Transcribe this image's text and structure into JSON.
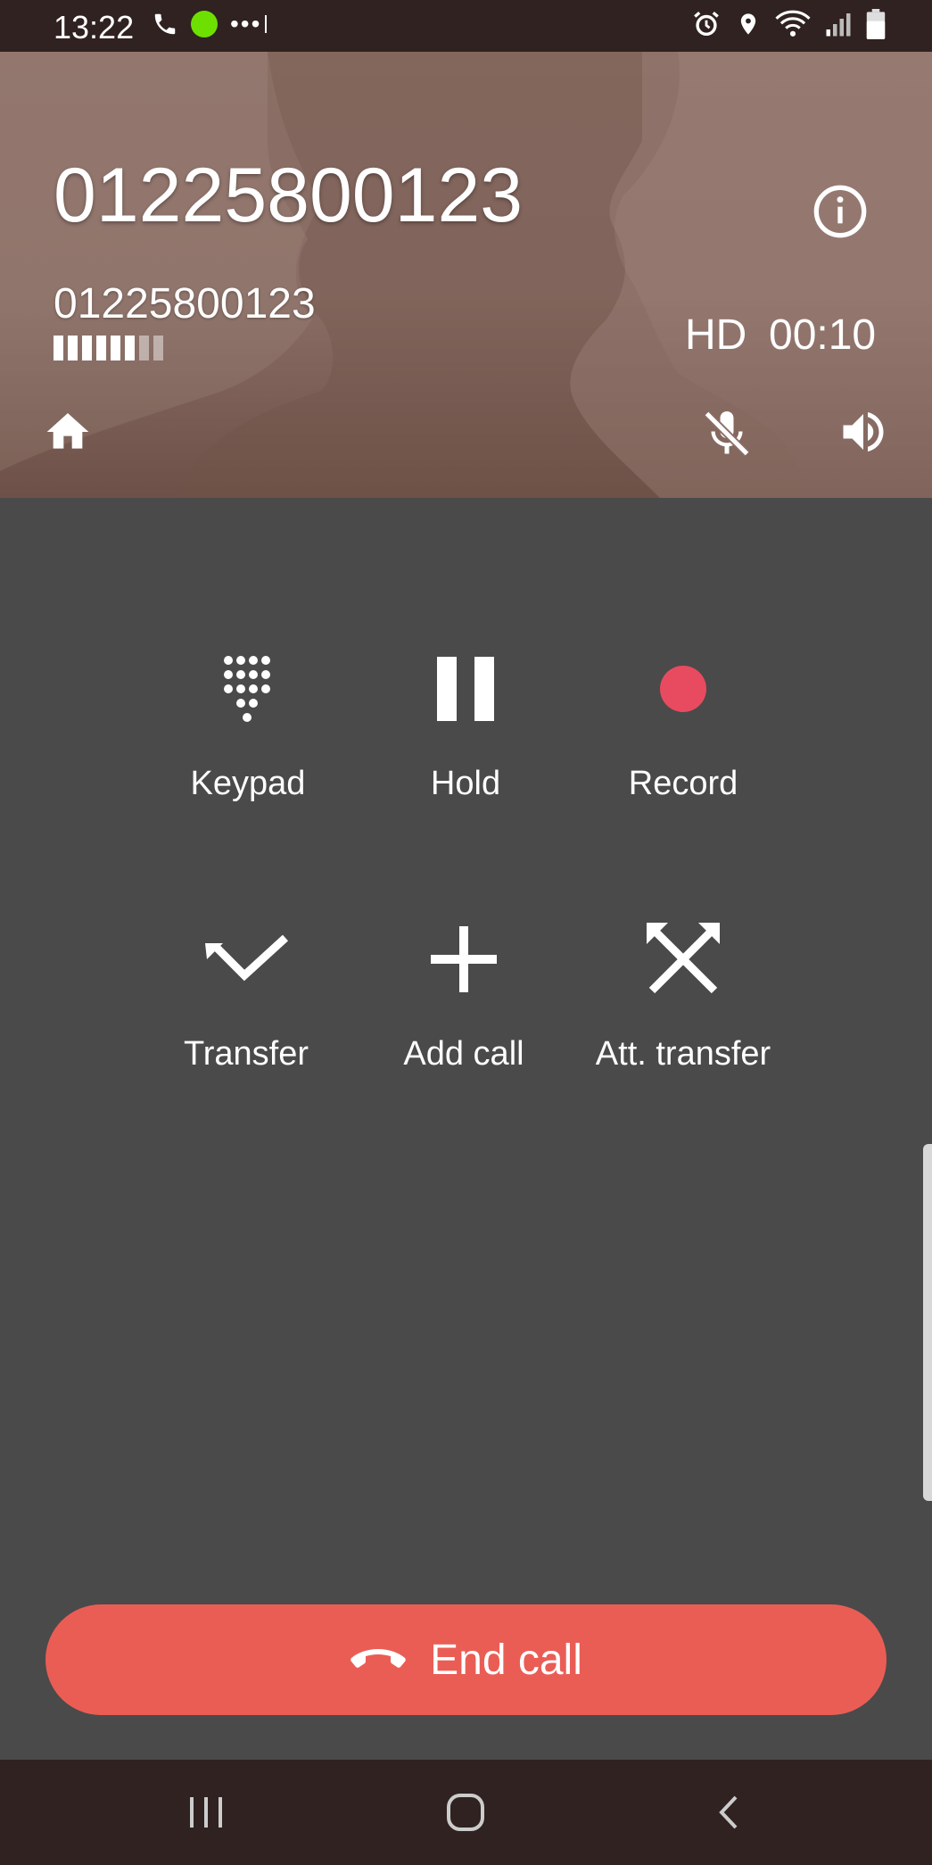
{
  "status_bar": {
    "time": "13:22",
    "more": "•••"
  },
  "call": {
    "name": "01225800123",
    "number": "01225800123",
    "quality": "HD",
    "duration": "00:10",
    "signal_strength": {
      "filled": 6,
      "total": 8
    }
  },
  "actions": [
    {
      "label": "Keypad",
      "icon": "dialpad-icon"
    },
    {
      "label": "Hold",
      "icon": "pause-icon"
    },
    {
      "label": "Record",
      "icon": "record-icon"
    },
    {
      "label": "Transfer",
      "icon": "transfer-icon"
    },
    {
      "label": "Add call",
      "icon": "plus-icon"
    },
    {
      "label": "Att. transfer",
      "icon": "attended-transfer-icon"
    }
  ],
  "end_call": {
    "label": "End call"
  },
  "colors": {
    "record": "#e84b5f",
    "end_call": "#ea5d55",
    "status_green": "#6ee000",
    "background": "#4a4a4a",
    "bars": "#2f2220"
  }
}
